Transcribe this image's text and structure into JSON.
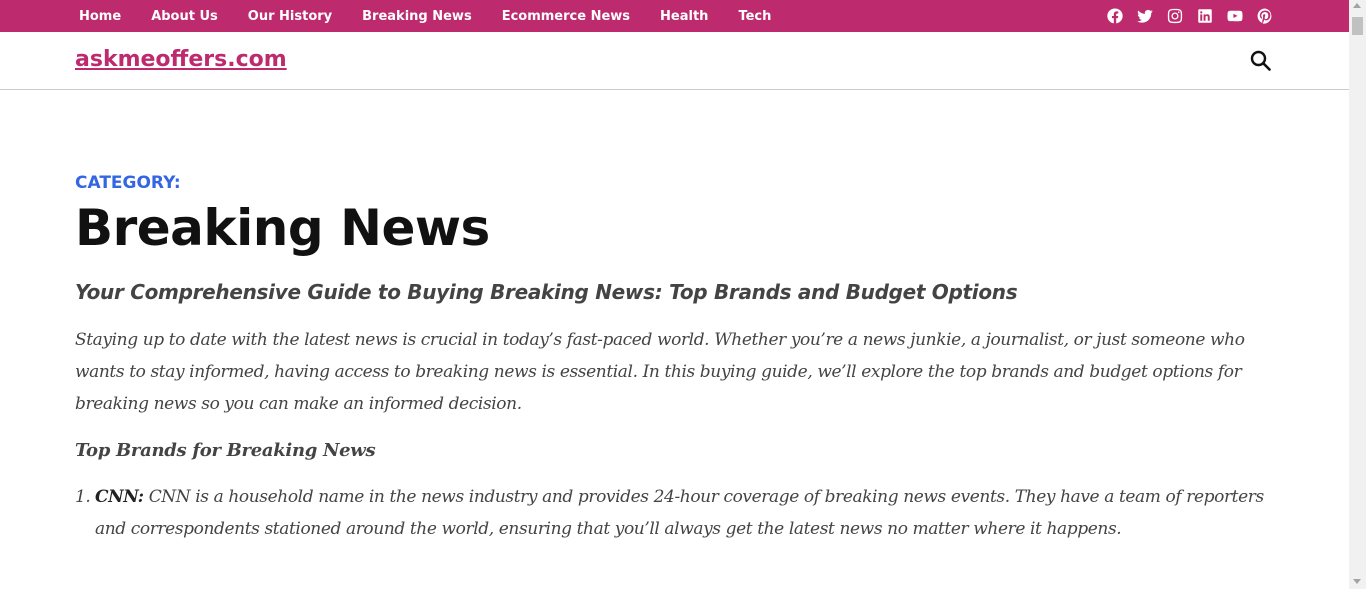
{
  "nav": {
    "items": [
      {
        "label": "Home"
      },
      {
        "label": "About Us"
      },
      {
        "label": "Our History"
      },
      {
        "label": "Breaking News"
      },
      {
        "label": "Ecommerce News"
      },
      {
        "label": "Health"
      },
      {
        "label": "Tech"
      }
    ],
    "social_icons": [
      "facebook-icon",
      "twitter-icon",
      "instagram-icon",
      "linkedin-icon",
      "youtube-icon",
      "pinterest-icon"
    ]
  },
  "header": {
    "site_name": "askmeoffers.com",
    "search_icon": "search-icon"
  },
  "colors": {
    "brand": "#bd2b6e",
    "category_label": "#3366e0",
    "text": "#444444"
  },
  "main": {
    "category_label": "CATEGORY:",
    "title": "Breaking News",
    "subtitle": "Your Comprehensive Guide to Buying Breaking News: Top Brands and Budget Options",
    "intro": "Staying up to date with the latest news is crucial in today’s fast-paced world. Whether you’re a news junkie, a journalist, or just someone who wants to stay informed, having access to breaking news is essential. In this buying guide, we’ll explore the top brands and budget options for breaking news so you can make an informed decision.",
    "section_heading": "Top Brands for Breaking News",
    "list": [
      {
        "number": "1.",
        "brand": "CNN:",
        "text": "CNN is a household name in the news industry and provides 24-hour coverage of breaking news events. They have a team of reporters and correspondents stationed around the world, ensuring that you’ll always get the latest news no matter where it happens."
      }
    ]
  }
}
